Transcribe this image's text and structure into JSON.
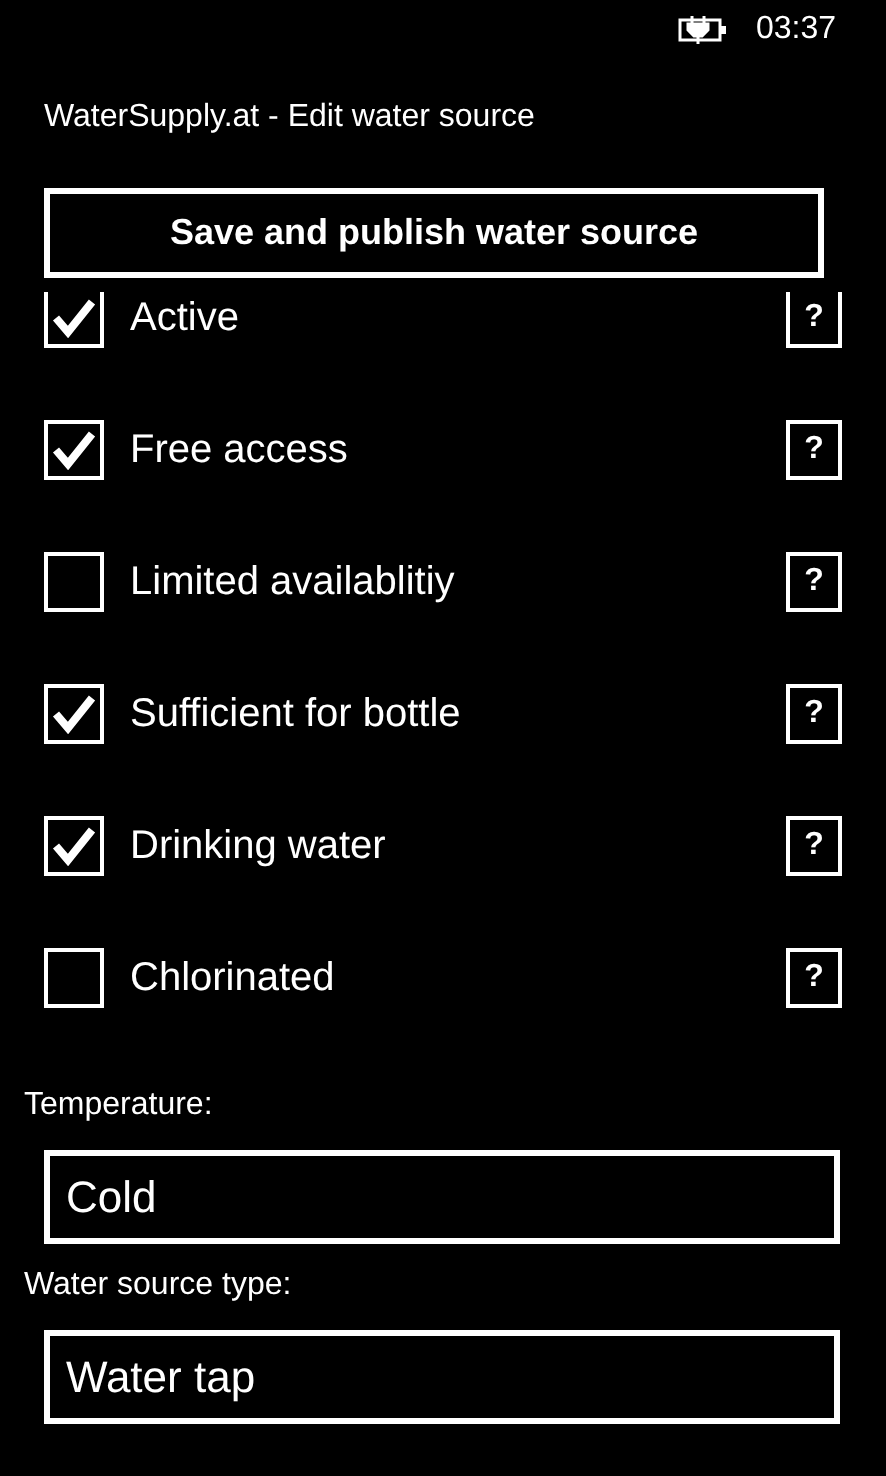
{
  "status_bar": {
    "time": "03:37"
  },
  "page_title": "WaterSupply.at - Edit water source",
  "save_button": "Save and publish water source",
  "options": [
    {
      "label": "Active",
      "checked": true,
      "help": "?"
    },
    {
      "label": "Free access",
      "checked": true,
      "help": "?"
    },
    {
      "label": "Limited availablitiy",
      "checked": false,
      "help": "?"
    },
    {
      "label": "Sufficient for bottle",
      "checked": true,
      "help": "?"
    },
    {
      "label": "Drinking water",
      "checked": true,
      "help": "?"
    },
    {
      "label": "Chlorinated",
      "checked": false,
      "help": "?"
    }
  ],
  "fields": [
    {
      "label": "Temperature:",
      "value": "Cold"
    },
    {
      "label": "Water source type:",
      "value": "Water tap"
    }
  ]
}
